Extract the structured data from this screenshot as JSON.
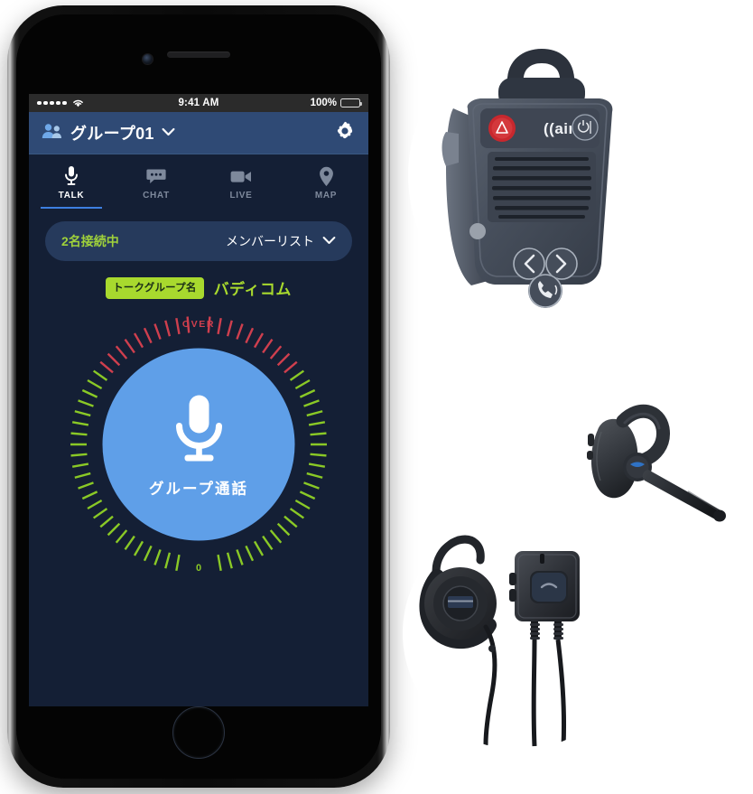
{
  "phone": {
    "device": "iPhone",
    "statusbar": {
      "signal_dots": 5,
      "wifi_icon": "wifi-icon",
      "time": "9:41 AM",
      "battery_percent": "100%",
      "battery_level": 100
    }
  },
  "app": {
    "header": {
      "group_icon": "group-people-icon",
      "group_name": "グループ01",
      "dropdown_icon": "chevron-down-icon",
      "settings_icon": "gear-icon"
    },
    "tabs": [
      {
        "id": "talk",
        "label": "TALK",
        "icon": "microphone-icon",
        "active": true
      },
      {
        "id": "chat",
        "label": "CHAT",
        "icon": "chat-bubble-icon",
        "active": false
      },
      {
        "id": "live",
        "label": "LIVE",
        "icon": "video-camera-icon",
        "active": false
      },
      {
        "id": "map",
        "label": "MAP",
        "icon": "map-pin-icon",
        "active": false
      }
    ],
    "member_bar": {
      "connected_label": "2名接続中",
      "member_list_label": "メンバーリスト",
      "chevron_icon": "chevron-down-icon"
    },
    "talk_group": {
      "badge_label": "トークグループ名",
      "name": "バディコム"
    },
    "dial": {
      "over_label": "OVER",
      "zero_label": "0",
      "tick_count": 72,
      "green_color": "#8ac926",
      "red_color": "#cf3f4e"
    },
    "talk_button": {
      "label": "グループ通話",
      "icon": "microphone-icon",
      "color": "#5f9fe8"
    },
    "colors": {
      "background": "#141f35",
      "header": "#2f4a75",
      "accent_blue": "#3d7fe0",
      "accent_green": "#a8d92e",
      "pill": "#263a5c"
    }
  },
  "products": [
    {
      "id": "radio",
      "name": "aina speaker microphone",
      "brand": "aina",
      "alert_color": "#d0262b"
    },
    {
      "id": "headset",
      "name": "bluetooth ear-hook headset"
    },
    {
      "id": "earpiece",
      "name": "ear-hook earpiece with ptt button"
    }
  ]
}
